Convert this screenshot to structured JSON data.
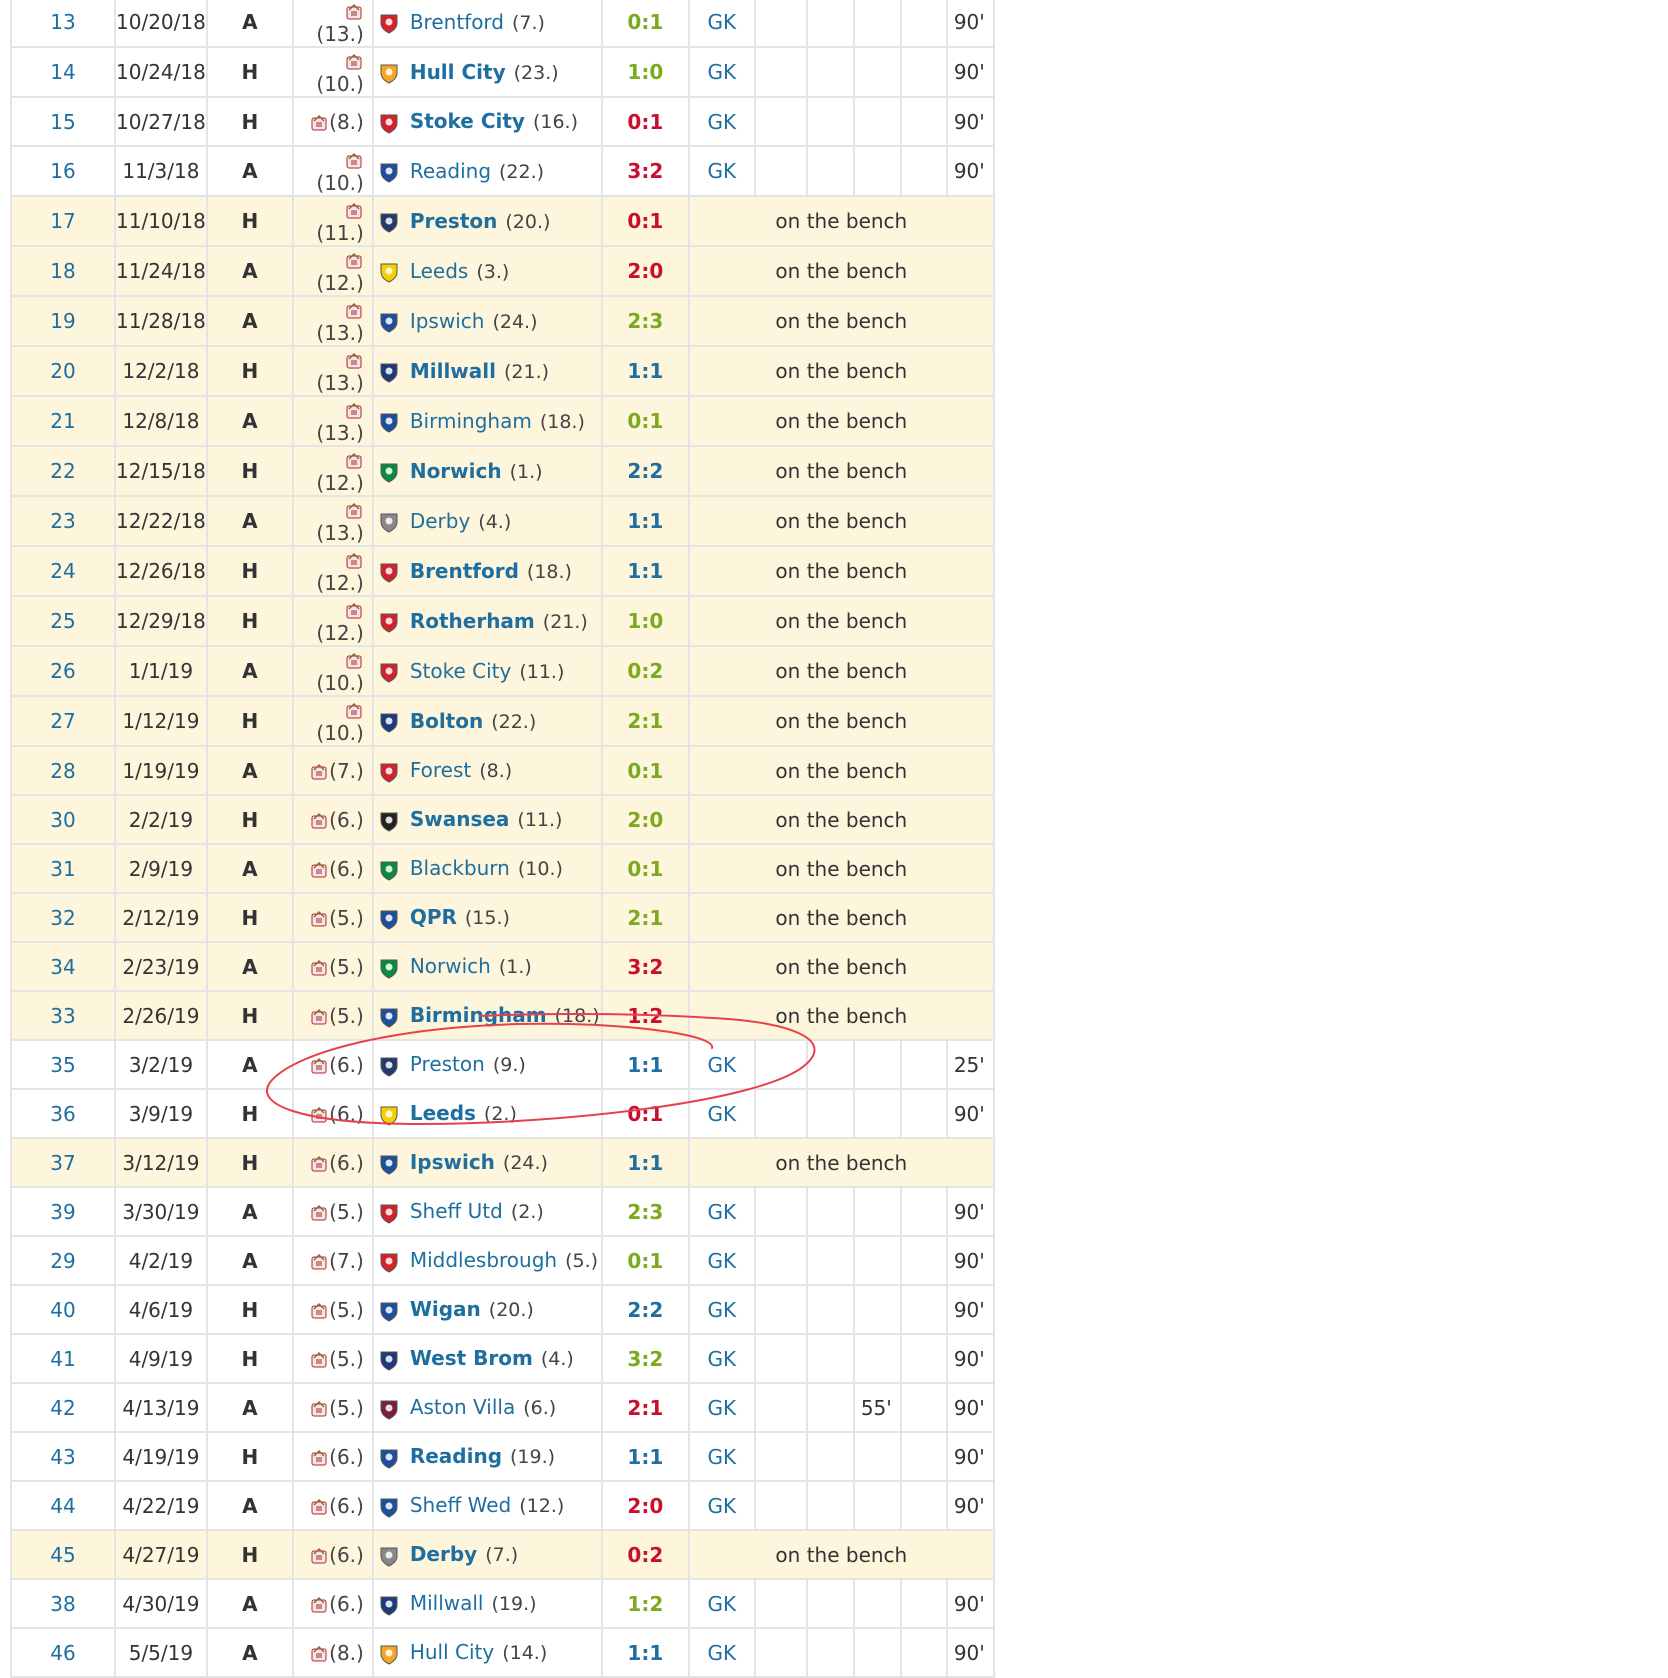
{
  "bench_label": "on the bench",
  "colors": {
    "win": "#7ba91f",
    "loss": "#c8102e",
    "draw": "#1e6fa0",
    "link": "#1e6fa0",
    "bench_bg": "#fdf5dc",
    "annotation": "#e8404a"
  },
  "rows": [
    {
      "md": "13",
      "date": "10/20/18",
      "ha": "A",
      "rank": "(13.)",
      "opp": "Brentford",
      "opp_rank": "(7.)",
      "result": "0:1",
      "res_type": "w",
      "pos": "GK",
      "col_a": "",
      "col_b": "",
      "mins": "90'",
      "bench": false,
      "crest": "#d2232a"
    },
    {
      "md": "14",
      "date": "10/24/18",
      "ha": "H",
      "rank": "(10.)",
      "opp": "Hull City",
      "opp_rank": "(23.)",
      "result": "1:0",
      "res_type": "w",
      "pos": "GK",
      "col_a": "",
      "col_b": "",
      "mins": "90'",
      "bench": false,
      "crest": "#f5a623"
    },
    {
      "md": "15",
      "date": "10/27/18",
      "ha": "H",
      "rank": "(8.)",
      "opp": "Stoke City",
      "opp_rank": "(16.)",
      "result": "0:1",
      "res_type": "l",
      "pos": "GK",
      "col_a": "",
      "col_b": "",
      "mins": "90'",
      "bench": false,
      "crest": "#d2232a"
    },
    {
      "md": "16",
      "date": "11/3/18",
      "ha": "A",
      "rank": "(10.)",
      "opp": "Reading",
      "opp_rank": "(22.)",
      "result": "3:2",
      "res_type": "l",
      "pos": "GK",
      "col_a": "",
      "col_b": "",
      "mins": "90'",
      "bench": false,
      "crest": "#1d4f9c"
    },
    {
      "md": "17",
      "date": "11/10/18",
      "ha": "H",
      "rank": "(11.)",
      "opp": "Preston",
      "opp_rank": "(20.)",
      "result": "0:1",
      "res_type": "l",
      "bench": true,
      "crest": "#233a6b"
    },
    {
      "md": "18",
      "date": "11/24/18",
      "ha": "A",
      "rank": "(12.)",
      "opp": "Leeds",
      "opp_rank": "(3.)",
      "result": "2:0",
      "res_type": "l",
      "bench": true,
      "crest": "#f5d000"
    },
    {
      "md": "19",
      "date": "11/28/18",
      "ha": "A",
      "rank": "(13.)",
      "opp": "Ipswich",
      "opp_rank": "(24.)",
      "result": "2:3",
      "res_type": "w",
      "bench": true,
      "crest": "#1d4f9c"
    },
    {
      "md": "20",
      "date": "12/2/18",
      "ha": "H",
      "rank": "(13.)",
      "opp": "Millwall",
      "opp_rank": "(21.)",
      "result": "1:1",
      "res_type": "d",
      "bench": true,
      "crest": "#1d3a7a"
    },
    {
      "md": "21",
      "date": "12/8/18",
      "ha": "A",
      "rank": "(13.)",
      "opp": "Birmingham",
      "opp_rank": "(18.)",
      "result": "0:1",
      "res_type": "w",
      "bench": true,
      "crest": "#1d4f9c"
    },
    {
      "md": "22",
      "date": "12/15/18",
      "ha": "H",
      "rank": "(12.)",
      "opp": "Norwich",
      "opp_rank": "(1.)",
      "result": "2:2",
      "res_type": "d",
      "bench": true,
      "crest": "#0a8a3a"
    },
    {
      "md": "23",
      "date": "12/22/18",
      "ha": "A",
      "rank": "(13.)",
      "opp": "Derby",
      "opp_rank": "(4.)",
      "result": "1:1",
      "res_type": "d",
      "bench": true,
      "crest": "#888888"
    },
    {
      "md": "24",
      "date": "12/26/18",
      "ha": "H",
      "rank": "(12.)",
      "opp": "Brentford",
      "opp_rank": "(18.)",
      "result": "1:1",
      "res_type": "d",
      "bench": true,
      "crest": "#d2232a"
    },
    {
      "md": "25",
      "date": "12/29/18",
      "ha": "H",
      "rank": "(12.)",
      "opp": "Rotherham",
      "opp_rank": "(21.)",
      "result": "1:0",
      "res_type": "w",
      "bench": true,
      "crest": "#d2232a"
    },
    {
      "md": "26",
      "date": "1/1/19",
      "ha": "A",
      "rank": "(10.)",
      "opp": "Stoke City",
      "opp_rank": "(11.)",
      "result": "0:2",
      "res_type": "w",
      "bench": true,
      "crest": "#d2232a"
    },
    {
      "md": "27",
      "date": "1/12/19",
      "ha": "H",
      "rank": "(10.)",
      "opp": "Bolton",
      "opp_rank": "(22.)",
      "result": "2:1",
      "res_type": "w",
      "bench": true,
      "crest": "#1d3a7a"
    },
    {
      "md": "28",
      "date": "1/19/19",
      "ha": "A",
      "rank": "(7.)",
      "opp": "Forest",
      "opp_rank": "(8.)",
      "result": "0:1",
      "res_type": "w",
      "bench": true,
      "crest": "#d2232a"
    },
    {
      "md": "30",
      "date": "2/2/19",
      "ha": "H",
      "rank": "(6.)",
      "opp": "Swansea",
      "opp_rank": "(11.)",
      "result": "2:0",
      "res_type": "w",
      "bench": true,
      "crest": "#222222"
    },
    {
      "md": "31",
      "date": "2/9/19",
      "ha": "A",
      "rank": "(6.)",
      "opp": "Blackburn",
      "opp_rank": "(10.)",
      "result": "0:1",
      "res_type": "w",
      "bench": true,
      "crest": "#0a8a3a"
    },
    {
      "md": "32",
      "date": "2/12/19",
      "ha": "H",
      "rank": "(5.)",
      "opp": "QPR",
      "opp_rank": "(15.)",
      "result": "2:1",
      "res_type": "w",
      "bench": true,
      "crest": "#1d4f9c"
    },
    {
      "md": "34",
      "date": "2/23/19",
      "ha": "A",
      "rank": "(5.)",
      "opp": "Norwich",
      "opp_rank": "(1.)",
      "result": "3:2",
      "res_type": "l",
      "bench": true,
      "crest": "#0a8a3a"
    },
    {
      "md": "33",
      "date": "2/26/19",
      "ha": "H",
      "rank": "(5.)",
      "opp": "Birmingham",
      "opp_rank": "(18.)",
      "result": "1:2",
      "res_type": "l",
      "bench": true,
      "crest": "#1d4f9c"
    },
    {
      "md": "35",
      "date": "3/2/19",
      "ha": "A",
      "rank": "(6.)",
      "opp": "Preston",
      "opp_rank": "(9.)",
      "result": "1:1",
      "res_type": "d",
      "pos": "GK",
      "col_a": "",
      "col_b": "",
      "mins": "25'",
      "bench": false,
      "crest": "#233a6b"
    },
    {
      "md": "36",
      "date": "3/9/19",
      "ha": "H",
      "rank": "(6.)",
      "opp": "Leeds",
      "opp_rank": "(2.)",
      "result": "0:1",
      "res_type": "l",
      "pos": "GK",
      "col_a": "",
      "col_b": "",
      "mins": "90'",
      "bench": false,
      "crest": "#f5d000"
    },
    {
      "md": "37",
      "date": "3/12/19",
      "ha": "H",
      "rank": "(6.)",
      "opp": "Ipswich",
      "opp_rank": "(24.)",
      "result": "1:1",
      "res_type": "d",
      "bench": true,
      "crest": "#1d4f9c"
    },
    {
      "md": "39",
      "date": "3/30/19",
      "ha": "A",
      "rank": "(5.)",
      "opp": "Sheff Utd",
      "opp_rank": "(2.)",
      "result": "2:3",
      "res_type": "w",
      "pos": "GK",
      "col_a": "",
      "col_b": "",
      "mins": "90'",
      "bench": false,
      "crest": "#d2232a"
    },
    {
      "md": "29",
      "date": "4/2/19",
      "ha": "A",
      "rank": "(7.)",
      "opp": "Middlesbrough",
      "opp_rank": "(5.)",
      "result": "0:1",
      "res_type": "w",
      "pos": "GK",
      "col_a": "",
      "col_b": "",
      "mins": "90'",
      "bench": false,
      "crest": "#d2232a"
    },
    {
      "md": "40",
      "date": "4/6/19",
      "ha": "H",
      "rank": "(5.)",
      "opp": "Wigan",
      "opp_rank": "(20.)",
      "result": "2:2",
      "res_type": "d",
      "pos": "GK",
      "col_a": "",
      "col_b": "",
      "mins": "90'",
      "bench": false,
      "crest": "#1d4f9c"
    },
    {
      "md": "41",
      "date": "4/9/19",
      "ha": "H",
      "rank": "(5.)",
      "opp": "West Brom",
      "opp_rank": "(4.)",
      "result": "3:2",
      "res_type": "w",
      "pos": "GK",
      "col_a": "",
      "col_b": "",
      "mins": "90'",
      "bench": false,
      "crest": "#1d3a7a"
    },
    {
      "md": "42",
      "date": "4/13/19",
      "ha": "A",
      "rank": "(5.)",
      "opp": "Aston Villa",
      "opp_rank": "(6.)",
      "result": "2:1",
      "res_type": "l",
      "pos": "GK",
      "col_a": "",
      "col_b": "55'",
      "mins": "90'",
      "bench": false,
      "crest": "#7a1e3a"
    },
    {
      "md": "43",
      "date": "4/19/19",
      "ha": "H",
      "rank": "(6.)",
      "opp": "Reading",
      "opp_rank": "(19.)",
      "result": "1:1",
      "res_type": "d",
      "pos": "GK",
      "col_a": "",
      "col_b": "",
      "mins": "90'",
      "bench": false,
      "crest": "#1d4f9c"
    },
    {
      "md": "44",
      "date": "4/22/19",
      "ha": "A",
      "rank": "(6.)",
      "opp": "Sheff Wed",
      "opp_rank": "(12.)",
      "result": "2:0",
      "res_type": "l",
      "pos": "GK",
      "col_a": "",
      "col_b": "",
      "mins": "90'",
      "bench": false,
      "crest": "#1d4f9c"
    },
    {
      "md": "45",
      "date": "4/27/19",
      "ha": "H",
      "rank": "(6.)",
      "opp": "Derby",
      "opp_rank": "(7.)",
      "result": "0:2",
      "res_type": "l",
      "bench": true,
      "crest": "#888888"
    },
    {
      "md": "38",
      "date": "4/30/19",
      "ha": "A",
      "rank": "(6.)",
      "opp": "Millwall",
      "opp_rank": "(19.)",
      "result": "1:2",
      "res_type": "w",
      "pos": "GK",
      "col_a": "",
      "col_b": "",
      "mins": "90'",
      "bench": false,
      "crest": "#1d3a7a"
    },
    {
      "md": "46",
      "date": "5/5/19",
      "ha": "A",
      "rank": "(8.)",
      "opp": "Hull City",
      "opp_rank": "(14.)",
      "result": "1:1",
      "res_type": "d",
      "pos": "GK",
      "col_a": "",
      "col_b": "",
      "mins": "90'",
      "bench": false,
      "crest": "#f5a623"
    }
  ]
}
